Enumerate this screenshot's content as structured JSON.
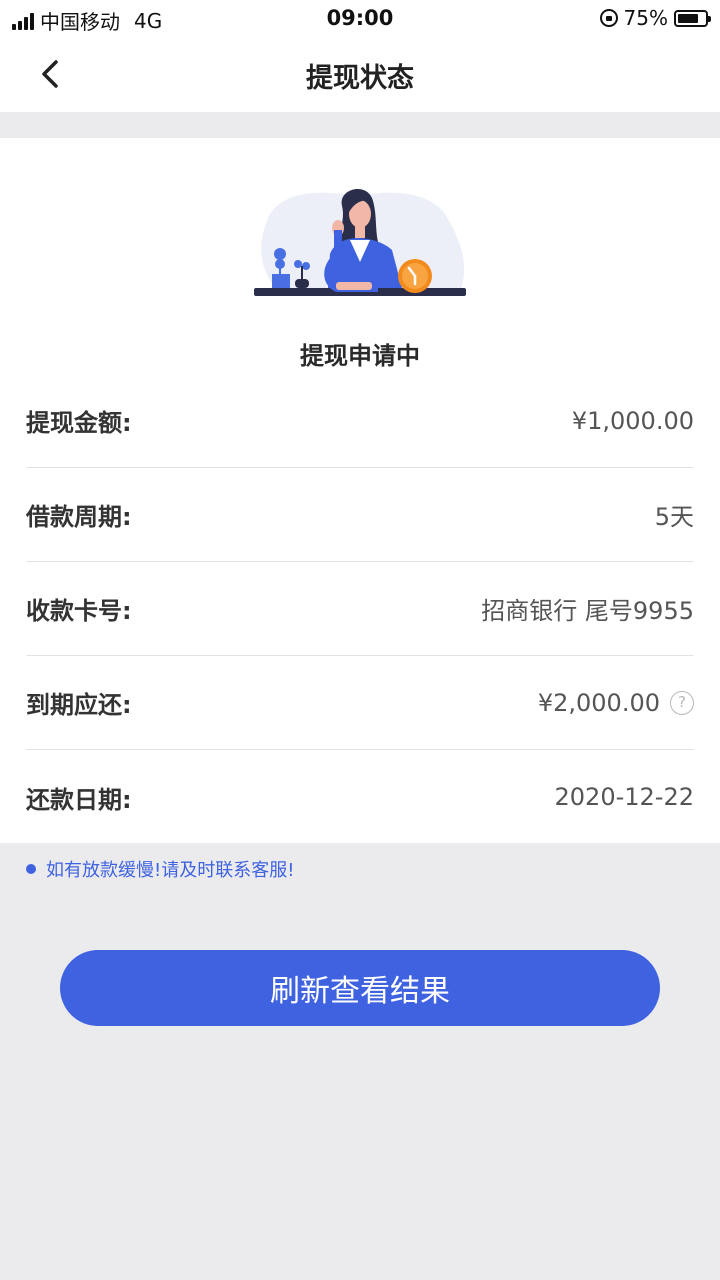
{
  "status_bar": {
    "carrier": "中国移动",
    "network": "4G",
    "time": "09:00",
    "battery": "75%",
    "battery_level": 0.75
  },
  "nav": {
    "title": "提现状态",
    "back_icon": "chevron-left-icon"
  },
  "status": {
    "title": "提现申请中"
  },
  "details": [
    {
      "label": "提现金额:",
      "value": "¥1,000.00"
    },
    {
      "label": "借款周期:",
      "value": "5天"
    },
    {
      "label": "收款卡号:",
      "value": "招商银行 尾号9955"
    },
    {
      "label": "到期应还:",
      "value": "¥2,000.00",
      "help_icon": "?"
    },
    {
      "label": "还款日期:",
      "value": "2020-12-22"
    }
  ],
  "notice": "如有放款缓慢!请及时联系客服!",
  "refresh_button": "刷新查看结果",
  "colors": {
    "accent": "#3f63e0",
    "background": "#ebebed",
    "card": "#ffffff",
    "clock": "#f28b1c"
  }
}
